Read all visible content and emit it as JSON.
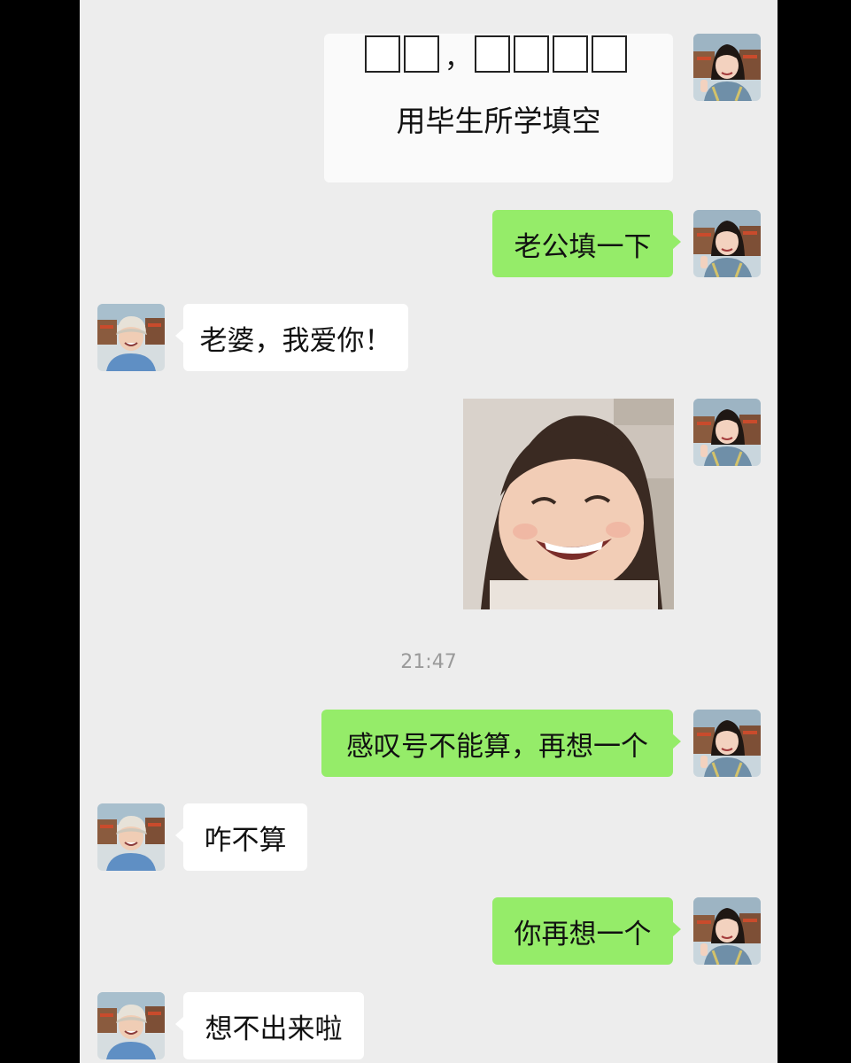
{
  "messages": {
    "m1_quiz": {
      "comma": "，",
      "text": "用毕生所学填空"
    },
    "m2": "老公填一下",
    "m3": "老婆，我爱你！",
    "m5": "感叹号不能算，再想一个",
    "m6": "咋不算",
    "m7": "你再想一个",
    "m8": "想不出来啦"
  },
  "timestamp": "21:47",
  "colors": {
    "chat_bg": "#ededed",
    "outgoing_bubble": "#95ec69",
    "incoming_bubble": "#ffffff"
  },
  "icons": {
    "her_avatar": "girl-portrait-avatar",
    "his_avatar": "boy-with-cap-avatar",
    "sticker": "laughing-child-photo"
  }
}
